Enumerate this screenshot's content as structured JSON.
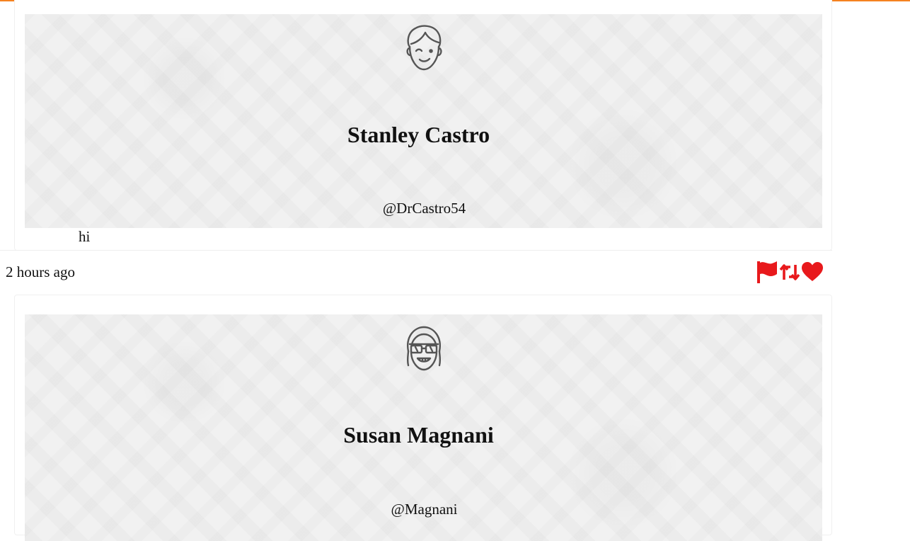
{
  "colors": {
    "accent_bar": "#f58220",
    "action_icons": "#e8191c"
  },
  "posts": [
    {
      "display_name": "Stanley Castro",
      "handle": "@DrCastro54",
      "text": "hi",
      "timestamp": "2 hours ago",
      "avatar_icon": "winking-boy-avatar-icon"
    },
    {
      "display_name": "Susan Magnani",
      "handle": "@Magnani",
      "avatar_icon": "sunglasses-girl-avatar-icon"
    }
  ],
  "actions": [
    {
      "name": "flag-icon"
    },
    {
      "name": "retweet-icon"
    },
    {
      "name": "heart-icon"
    }
  ]
}
